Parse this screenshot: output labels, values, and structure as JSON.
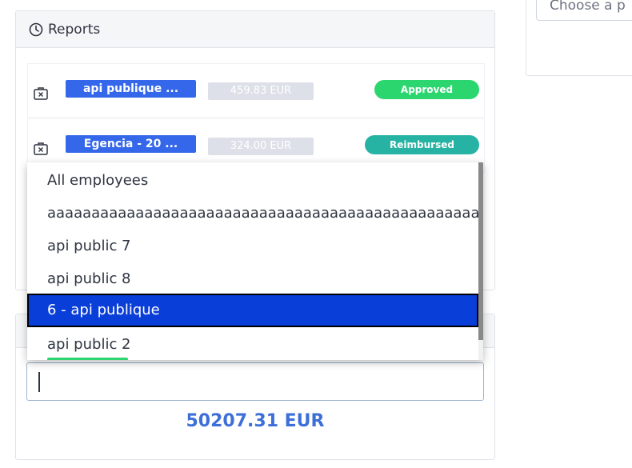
{
  "reports": {
    "title": "Reports",
    "icon": "clock-icon",
    "rows": [
      {
        "icon": "suitcase-icon",
        "name": "api publique ...",
        "amount": "459.83 EUR",
        "status": "Approved",
        "status_color": "#2bd66e"
      },
      {
        "icon": "suitcase-icon",
        "name": "Egencia - 20 ...",
        "amount": "324.00 EUR",
        "status": "Reimbursed",
        "status_color": "#26b3a3"
      }
    ]
  },
  "right_panel": {
    "select_placeholder": "Choose a p"
  },
  "employee_dropdown": {
    "options": [
      "All employees",
      "aaaaaaaaaaaaaaaaaaaaaaaaaaaaaaaaaaaaaaaaaaaaaaaaaaaaa",
      "api public 7",
      "api public 8",
      "6 - api publique",
      "api public 2"
    ],
    "selected": "6 - api publique"
  },
  "employee_search": {
    "value": ""
  },
  "totals": {
    "amount": "50207.31 EUR"
  },
  "colors": {
    "accent": "#3567ea",
    "selected": "#0a3ed8",
    "approved": "#2bd66e",
    "reimbursed": "#26b3a3"
  }
}
